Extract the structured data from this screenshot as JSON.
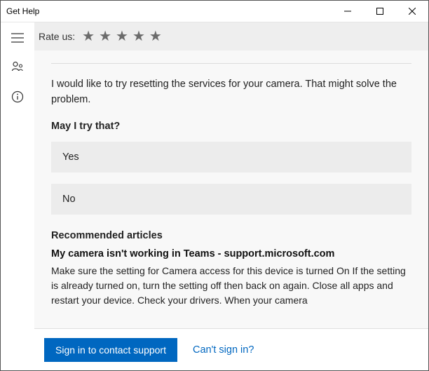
{
  "window": {
    "title": "Get Help"
  },
  "rate": {
    "label": "Rate us:"
  },
  "assistant": {
    "message": "I would like to try resetting the services for your camera. That might solve the problem.",
    "question": "May I try that?",
    "option_yes": "Yes",
    "option_no": "No"
  },
  "recommended": {
    "heading": "Recommended articles",
    "article_title": "My camera isn't working in Teams - support.microsoft.com",
    "article_snippet": "Make sure the setting for Camera access for this device is turned On If the setting is already turned on, turn the setting off then back on again. Close all apps and restart your device. Check your drivers. When your camera"
  },
  "footer": {
    "signin_button": "Sign in to contact support",
    "cant_signin": "Can't sign in?"
  }
}
